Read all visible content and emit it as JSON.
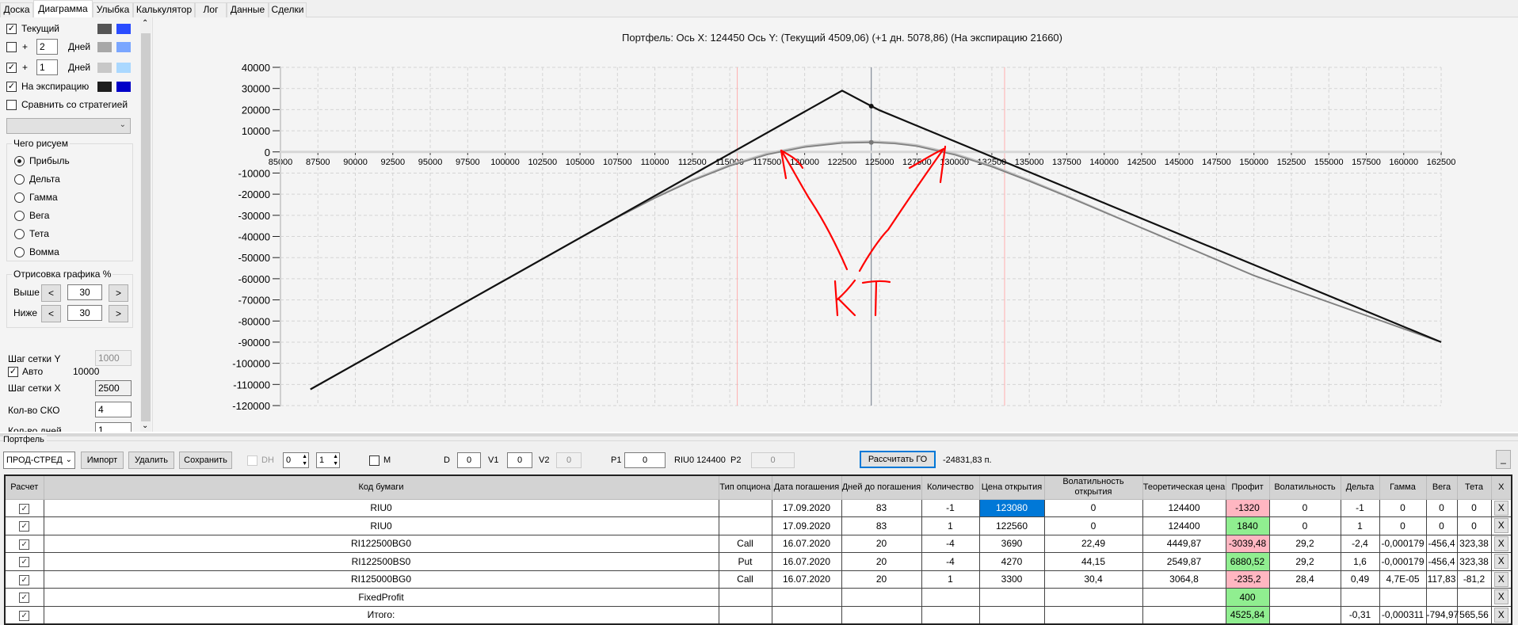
{
  "tabs": [
    "Доска",
    "Диаграмма",
    "Улыбка",
    "Калькулятор",
    "Лог",
    "Данные",
    "Сделки"
  ],
  "active_tab": "Диаграмма",
  "left": {
    "current_label": "Текущий",
    "current_checked": true,
    "plus_sign": "+",
    "days_label": "Дней",
    "days1_value": "2",
    "days1_checked": false,
    "days2_value": "1",
    "days2_checked": true,
    "expiration_label": "На экспирацию",
    "expiration_checked": true,
    "compare_label": "Сравнить со стратегией",
    "compare_checked": false,
    "swatches": {
      "current": [
        "#555555",
        "#2a4cff"
      ],
      "days1": [
        "#a8a8a8",
        "#7aa6ff"
      ],
      "days2": [
        "#c8c8c8",
        "#aad8ff"
      ],
      "expiration": [
        "#1e1e1e",
        "#0000c8"
      ]
    },
    "draw_group": {
      "title": "Чего рисуем",
      "options": [
        "Прибыль",
        "Дельта",
        "Гамма",
        "Вега",
        "Тета",
        "Вомма"
      ],
      "selected": "Прибыль"
    },
    "range_group": {
      "title": "Отрисовка графика %",
      "above_label": "Выше",
      "above_value": "30",
      "below_label": "Ниже",
      "below_value": "30",
      "dec": "<",
      "inc": ">"
    },
    "grid_y_label": "Шаг сетки Y",
    "grid_y_value": "1000",
    "auto_label": "Авто",
    "auto_value": "10000",
    "grid_x_label": "Шаг сетки X",
    "grid_x_value": "2500",
    "sko_label": "Кол-во СКО",
    "sko_value": "4",
    "days_count_label": "Кол-во дней",
    "days_count_value": "1"
  },
  "chart_data": {
    "type": "line",
    "title": "Портфель: Ось X: 124450 Ось Y:  (Текущий 4509,06)  (+1 дн. 5078,86)  (На экспирацию 21660)",
    "xlim": [
      85000,
      162500
    ],
    "ylim": [
      -120000,
      40000
    ],
    "x_ticks": [
      85000,
      87500,
      90000,
      92500,
      95000,
      97500,
      100000,
      102500,
      105000,
      107500,
      110000,
      112500,
      115000,
      117500,
      120000,
      122500,
      125000,
      127500,
      130000,
      132500,
      135000,
      137500,
      140000,
      142500,
      145000,
      147500,
      150000,
      152500,
      155000,
      157500,
      160000,
      162500
    ],
    "y_ticks": [
      40000,
      30000,
      20000,
      10000,
      0,
      -10000,
      -20000,
      -30000,
      -40000,
      -50000,
      -60000,
      -70000,
      -80000,
      -90000,
      -100000,
      -110000,
      -120000
    ],
    "grid": true,
    "cursor_x": 124450,
    "sd_lines": [
      115500,
      133350
    ],
    "series": [
      {
        "name": "На экспирацию",
        "color": "#111111",
        "points": [
          [
            87000,
            -112300
          ],
          [
            122500,
            29000
          ],
          [
            124450,
            21660
          ],
          [
            125000,
            19700
          ],
          [
            162500,
            -90000
          ]
        ]
      },
      {
        "name": "Текущий",
        "color": "#808080",
        "points": [
          [
            87000,
            -112300
          ],
          [
            100000,
            -60700
          ],
          [
            105000,
            -40800
          ],
          [
            107500,
            -31000
          ],
          [
            110000,
            -21800
          ],
          [
            112500,
            -13600
          ],
          [
            115000,
            -6600
          ],
          [
            117500,
            -1200
          ],
          [
            120000,
            2300
          ],
          [
            122500,
            4200
          ],
          [
            124450,
            4509
          ],
          [
            126000,
            4000
          ],
          [
            127500,
            2700
          ],
          [
            130000,
            -1300
          ],
          [
            132500,
            -7000
          ],
          [
            135000,
            -13800
          ],
          [
            137500,
            -21000
          ],
          [
            140000,
            -28500
          ],
          [
            142500,
            -36000
          ],
          [
            145000,
            -43500
          ],
          [
            150000,
            -58500
          ],
          [
            162500,
            -90000
          ]
        ]
      },
      {
        "name": "+1 дн.",
        "color": "#c4c4c4",
        "points": [
          [
            87000,
            -112300
          ],
          [
            100000,
            -60600
          ],
          [
            105000,
            -40600
          ],
          [
            107500,
            -30700
          ],
          [
            110000,
            -21400
          ],
          [
            112500,
            -13100
          ],
          [
            115000,
            -6000
          ],
          [
            117500,
            -600
          ],
          [
            120000,
            2900
          ],
          [
            122500,
            4800
          ],
          [
            124450,
            5079
          ],
          [
            126000,
            4600
          ],
          [
            127500,
            3300
          ],
          [
            130000,
            -700
          ],
          [
            132500,
            -6400
          ],
          [
            135000,
            -13300
          ],
          [
            137500,
            -20600
          ],
          [
            140000,
            -28200
          ],
          [
            142500,
            -35800
          ],
          [
            145000,
            -43300
          ],
          [
            150000,
            -58400
          ],
          [
            162500,
            -90000
          ]
        ]
      }
    ],
    "markers": [
      [
        124450,
        21660
      ],
      [
        124450,
        4509
      ]
    ],
    "annotation": "КТ"
  },
  "portfolio": {
    "group_title": "Портфель",
    "strategy_select": "ПРОД-СТРЕД",
    "import_label": "Импорт",
    "delete_label": "Удалить",
    "save_label": "Сохранить",
    "dh_label": "DH",
    "spin1": "0",
    "spin2": "1",
    "m_label": "M",
    "d_label": "D",
    "d_value": "0",
    "v1_label": "V1",
    "v1_value": "0",
    "v2_label": "V2",
    "v2_value": "0",
    "p1_label": "P1",
    "p1_value": "0",
    "riu_text": "RIU0 124400",
    "p2_label": "P2",
    "p2_value": "0",
    "calc_go_label": "Рассчитать ГО",
    "go_value": "-24831,83 п.",
    "minimize_label": "_"
  },
  "table": {
    "columns": [
      "Расчет",
      "Код бумаги",
      "Тип опциона",
      "Дата погашения",
      "Дней до погашения",
      "Количество",
      "Цена открытия",
      "Волатильность открытия",
      "Теоретическая цена",
      "Профит",
      "Волатильность",
      "Дельта",
      "Гамма",
      "Вега",
      "Тета",
      "X"
    ],
    "rows": [
      {
        "code": "RIU0",
        "type": "",
        "date": "17.09.2020",
        "days": "83",
        "qty": "-1",
        "open": "123080",
        "open_vol": "0",
        "theo": "124400",
        "profit": "-1320",
        "vol": "0",
        "delta": "-1",
        "gamma": "0",
        "vega": "0",
        "theta": "0"
      },
      {
        "code": "RIU0",
        "type": "",
        "date": "17.09.2020",
        "days": "83",
        "qty": "1",
        "open": "122560",
        "open_vol": "0",
        "theo": "124400",
        "profit": "1840",
        "vol": "0",
        "delta": "1",
        "gamma": "0",
        "vega": "0",
        "theta": "0"
      },
      {
        "code": "RI122500BG0",
        "type": "Call",
        "date": "16.07.2020",
        "days": "20",
        "qty": "-4",
        "open": "3690",
        "open_vol": "22,49",
        "theo": "4449,87",
        "profit": "-3039,48",
        "vol": "29,2",
        "delta": "-2,4",
        "gamma": "-0,000179",
        "vega": "-456,4",
        "theta": "323,38"
      },
      {
        "code": "RI122500BS0",
        "type": "Put",
        "date": "16.07.2020",
        "days": "20",
        "qty": "-4",
        "open": "4270",
        "open_vol": "44,15",
        "theo": "2549,87",
        "profit": "6880,52",
        "vol": "29,2",
        "delta": "1,6",
        "gamma": "-0,000179",
        "vega": "-456,4",
        "theta": "323,38"
      },
      {
        "code": "RI125000BG0",
        "type": "Call",
        "date": "16.07.2020",
        "days": "20",
        "qty": "1",
        "open": "3300",
        "open_vol": "30,4",
        "theo": "3064,8",
        "profit": "-235,2",
        "vol": "28,4",
        "delta": "0,49",
        "gamma": "4,7E-05",
        "vega": "117,83",
        "theta": "-81,2"
      },
      {
        "code": "FixedProfit",
        "type": "",
        "date": "",
        "days": "",
        "qty": "",
        "open": "",
        "open_vol": "",
        "theo": "",
        "profit": "400",
        "vol": "",
        "delta": "",
        "gamma": "",
        "vega": "",
        "theta": ""
      },
      {
        "code": "Итого:",
        "type": "",
        "date": "",
        "days": "",
        "qty": "",
        "open": "",
        "open_vol": "",
        "theo": "",
        "profit": "4525,84",
        "vol": "",
        "delta": "-0,31",
        "gamma": "-0,000311",
        "vega": "-794,97",
        "theta": "565,56"
      }
    ],
    "remove_label": "X",
    "check_mark": "✓",
    "colors": {
      "negative": "#ffb6c1",
      "positive": "#90ee90",
      "selected": "#0078d7"
    }
  }
}
